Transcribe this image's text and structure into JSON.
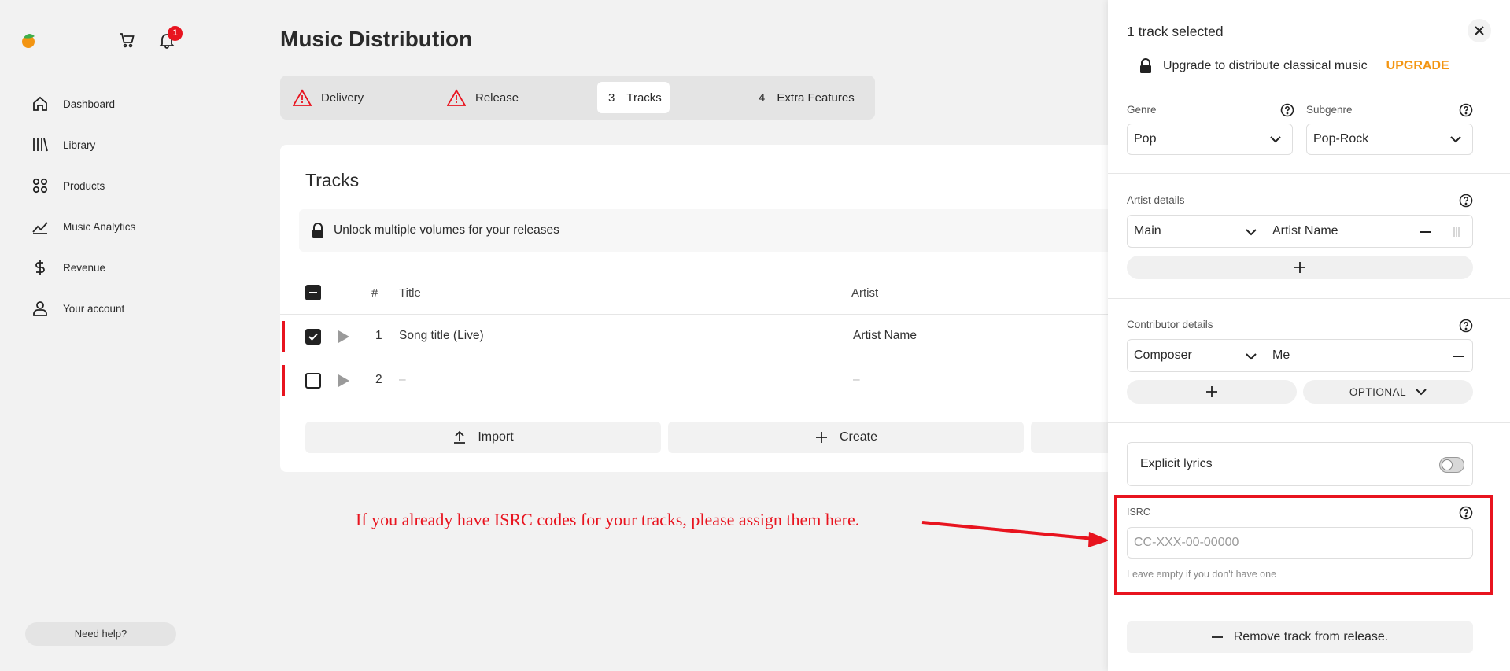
{
  "sidebar": {
    "notification_count": "1",
    "items": [
      {
        "label": "Dashboard",
        "icon": "home-icon"
      },
      {
        "label": "Library",
        "icon": "library-icon"
      },
      {
        "label": "Products",
        "icon": "products-icon"
      },
      {
        "label": "Music Analytics",
        "icon": "analytics-icon"
      },
      {
        "label": "Revenue",
        "icon": "dollar-icon"
      },
      {
        "label": "Your account",
        "icon": "user-icon"
      }
    ],
    "help_label": "Need help?"
  },
  "main": {
    "title": "Music Distribution",
    "steps": [
      {
        "label": "Delivery",
        "status": "warning"
      },
      {
        "label": "Release",
        "status": "warning"
      },
      {
        "number": "3",
        "label": "Tracks",
        "status": "active"
      },
      {
        "number": "4",
        "label": "Extra Features",
        "status": "pending"
      }
    ],
    "card_title": "Tracks",
    "unlock_text": "Unlock multiple volumes for your releases",
    "table": {
      "headers": {
        "num": "#",
        "title": "Title",
        "artist": "Artist"
      },
      "rows": [
        {
          "num": "1",
          "title": "Song title (Live)",
          "artist": "Artist Name",
          "checked": true
        },
        {
          "num": "2",
          "title": "–",
          "artist": "–",
          "checked": false
        }
      ]
    },
    "import_label": "Import",
    "create_label": "Create"
  },
  "annotation": {
    "text": "If you already have ISRC codes for your tracks, please assign them here."
  },
  "panel": {
    "title": "1 track selected",
    "upgrade_text": "Upgrade to distribute classical music",
    "upgrade_link": "UPGRADE",
    "genre_label": "Genre",
    "genre_value": "Pop",
    "subgenre_label": "Subgenre",
    "subgenre_value": "Pop-Rock",
    "artist_details_label": "Artist details",
    "artist_role": "Main",
    "artist_name": "Artist Name",
    "contributor_details_label": "Contributor details",
    "contributor_role": "Composer",
    "contributor_name": "Me",
    "optional_label": "OPTIONAL",
    "explicit_label": "Explicit lyrics",
    "isrc_label": "ISRC",
    "isrc_placeholder": "CC-XXX-00-00000",
    "isrc_hint": "Leave empty if you don't have one",
    "remove_label": "Remove track from release."
  },
  "colors": {
    "accent_red": "#e8141f",
    "upgrade_orange": "#f39512"
  }
}
